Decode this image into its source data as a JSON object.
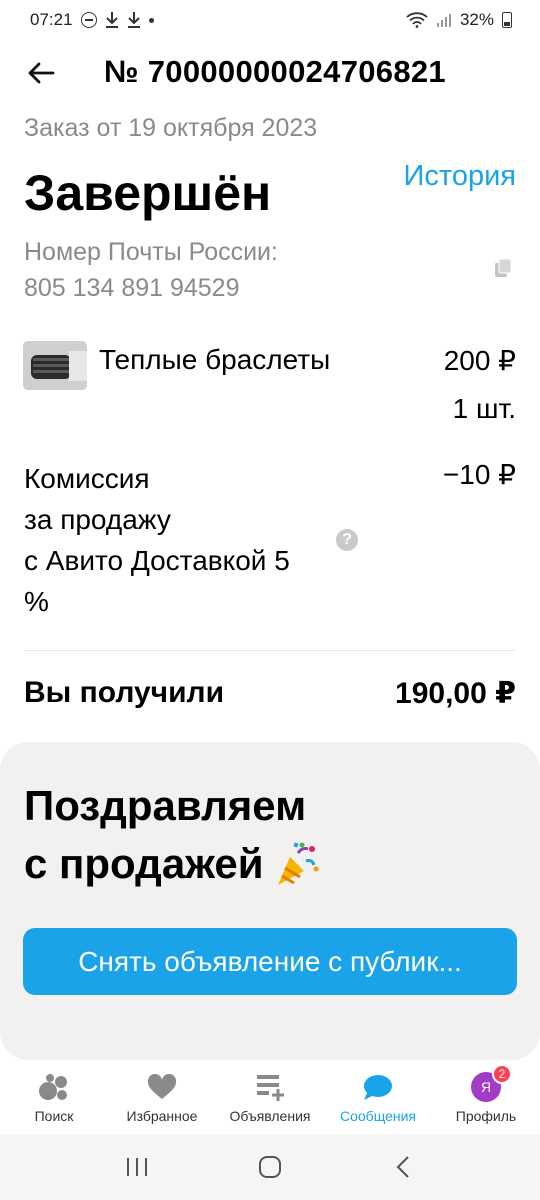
{
  "status_bar": {
    "time": "07:21",
    "battery": "32%"
  },
  "header": {
    "order_number": "№ 70000000024706821"
  },
  "order": {
    "date": "Заказ от 19 октября 2023",
    "status": "Завершён",
    "history_link": "История",
    "tracking_label": "Номер Почты России:",
    "tracking_number": "805 134 891 94529"
  },
  "item": {
    "title": "Теплые браслеты",
    "price": "200 ₽",
    "quantity": "1 шт."
  },
  "commission": {
    "line1": "Комиссия",
    "line2": "за продажу",
    "line3": "с Авито Доставкой 5",
    "line4": "%",
    "value": "−10 ₽",
    "help_glyph": "?"
  },
  "received": {
    "label": "Вы получили",
    "value": "190,00 ₽"
  },
  "congrats": {
    "line1": "Поздравляем",
    "line2": "с продажей",
    "button_label": "Снять объявление с публик..."
  },
  "bottom_nav": {
    "items": [
      {
        "label": "Поиск",
        "icon": "search-bubbles-icon"
      },
      {
        "label": "Избранное",
        "icon": "heart-icon"
      },
      {
        "label": "Объявления",
        "icon": "listings-add-icon"
      },
      {
        "label": "Сообщения",
        "icon": "chat-bubble-icon",
        "active": true
      },
      {
        "label": "Профиль",
        "icon": "profile-avatar",
        "avatar_letter": "Я",
        "badge": "2"
      }
    ]
  },
  "colors": {
    "accent": "#1aa3e8",
    "muted_text": "#8a8a8a",
    "card_bg": "#f2f1f0",
    "badge": "#ff4053",
    "avatar": "#a23cc8"
  }
}
